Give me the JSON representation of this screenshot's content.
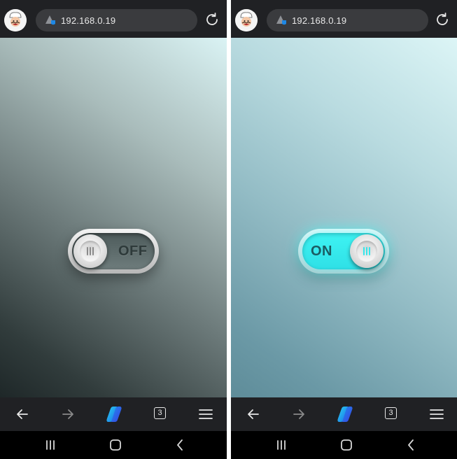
{
  "screens": [
    {
      "side": "left",
      "address_bar": {
        "url": "192.168.0.19"
      },
      "toggle": {
        "state": "off",
        "label": "OFF"
      },
      "bottom_bar": {
        "tab_count": "3"
      }
    },
    {
      "side": "right",
      "address_bar": {
        "url": "192.168.0.19"
      },
      "toggle": {
        "state": "on",
        "label": "ON"
      },
      "bottom_bar": {
        "tab_count": "3"
      }
    }
  ],
  "icons": {
    "avatar": "chef-avatar-icon",
    "site": "site-security-icon",
    "reload": "reload-icon",
    "back": "arrow-left-icon",
    "forward": "arrow-right-icon",
    "copilot": "copilot-icon",
    "tabs": "tabs-icon",
    "menu": "hamburger-menu-icon",
    "recents": "recents-icon",
    "home": "home-icon",
    "system_back": "chevron-left-icon"
  },
  "colors": {
    "toggle_on_accent": "#2fe5ea",
    "toggle_off_track": "#5b6969",
    "browser_chrome": "#202124"
  }
}
